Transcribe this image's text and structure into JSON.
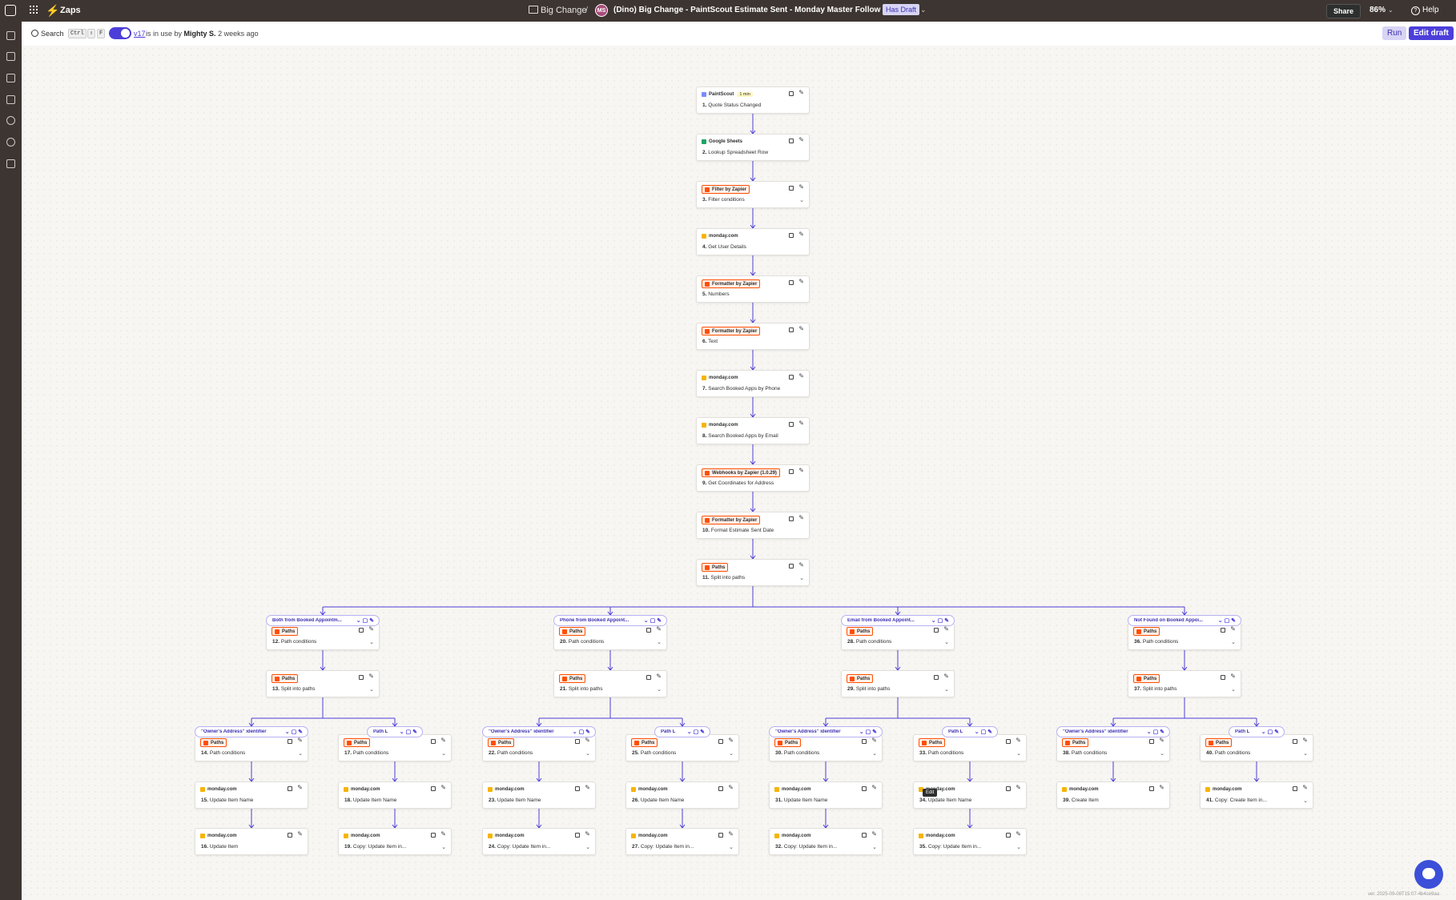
{
  "topbar": {
    "app_name": "Zaps",
    "folder": "Big Change",
    "separator": "/",
    "owner_initials": "MS",
    "zap_title": "(Dino) Big Change - PaintScout Estimate Sent - Monday Master Follow Up Board",
    "draft_badge": "Has Draft",
    "share": "Share",
    "zoom": "86%",
    "help": "Help"
  },
  "subbar": {
    "search": "Search",
    "kbd_ctrl": "Ctrl",
    "kbd_shift": "⇧",
    "kbd_f": "F",
    "version": "v17",
    "in_use_text": "is in use by",
    "user": "Mighty S.",
    "ago": "2 weeks ago",
    "run": "Run",
    "edit_draft": "Edit draft"
  },
  "steps": [
    {
      "app": "PaintScout",
      "num": "1.",
      "title": "Quote Status Changed",
      "time": "1 min",
      "color": "#7a8cff"
    },
    {
      "app": "Google Sheets",
      "num": "2.",
      "title": "Lookup Spreadsheet Row",
      "color": "#1fa463"
    },
    {
      "app": "Filter by Zapier",
      "num": "3.",
      "title": "Filter conditions",
      "color": "#ff4f00"
    },
    {
      "app": "monday.com",
      "num": "4.",
      "title": "Get User Details",
      "color": "#f6b400"
    },
    {
      "app": "Formatter by Zapier",
      "num": "5.",
      "title": "Numbers",
      "color": "#ff4f00"
    },
    {
      "app": "Formatter by Zapier",
      "num": "6.",
      "title": "Text",
      "color": "#ff4f00"
    },
    {
      "app": "monday.com",
      "num": "7.",
      "title": "Search Booked Apps by Phone",
      "color": "#f6b400"
    },
    {
      "app": "monday.com",
      "num": "8.",
      "title": "Search Booked Apps by Email",
      "color": "#f6b400"
    },
    {
      "app": "Webhooks by Zapier (1.0.29)",
      "num": "9.",
      "title": "Get Coordinates for Address",
      "color": "#ff4f00"
    },
    {
      "app": "Formatter by Zapier",
      "num": "10.",
      "title": "Format Estimate Sent Date",
      "color": "#ff4f00"
    },
    {
      "app": "Paths",
      "num": "11.",
      "title": "Split into paths",
      "color": "#ff4f00"
    },
    {
      "app": "Paths",
      "num": "12.",
      "title": "Path conditions",
      "color": "#ff4f00"
    },
    {
      "app": "Paths",
      "num": "13.",
      "title": "Split into paths",
      "color": "#ff4f00"
    },
    {
      "app": "Paths",
      "num": "20.",
      "title": "Path conditions",
      "color": "#ff4f00"
    },
    {
      "app": "Paths",
      "num": "21.",
      "title": "Split into paths",
      "color": "#ff4f00"
    },
    {
      "app": "Paths",
      "num": "28.",
      "title": "Path conditions",
      "color": "#ff4f00"
    },
    {
      "app": "Paths",
      "num": "29.",
      "title": "Split into paths",
      "color": "#ff4f00"
    },
    {
      "app": "Paths",
      "num": "36.",
      "title": "Path conditions",
      "color": "#ff4f00"
    },
    {
      "app": "Paths",
      "num": "37.",
      "title": "Split into paths",
      "color": "#ff4f00"
    },
    {
      "app": "Paths",
      "num": "14.",
      "title": "Path conditions",
      "color": "#ff4f00"
    },
    {
      "app": "monday.com",
      "num": "15.",
      "title": "Update Item Name",
      "color": "#f6b400"
    },
    {
      "app": "monday.com",
      "num": "16.",
      "title": "Update Item",
      "color": "#f6b400"
    },
    {
      "app": "Paths",
      "num": "17.",
      "title": "Path conditions",
      "color": "#ff4f00"
    },
    {
      "app": "monday.com",
      "num": "18.",
      "title": "Update Item Name",
      "color": "#f6b400"
    },
    {
      "app": "monday.com",
      "num": "19.",
      "title": "Copy: Update Item in...",
      "color": "#f6b400"
    },
    {
      "app": "Paths",
      "num": "22.",
      "title": "Path conditions",
      "color": "#ff4f00"
    },
    {
      "app": "monday.com",
      "num": "23.",
      "title": "Update Item Name",
      "color": "#f6b400"
    },
    {
      "app": "monday.com",
      "num": "24.",
      "title": "Copy: Update Item in...",
      "color": "#f6b400"
    },
    {
      "app": "Paths",
      "num": "25.",
      "title": "Path conditions",
      "color": "#ff4f00"
    },
    {
      "app": "monday.com",
      "num": "26.",
      "title": "Update Item Name",
      "color": "#f6b400"
    },
    {
      "app": "monday.com",
      "num": "27.",
      "title": "Copy: Update Item in...",
      "color": "#f6b400"
    },
    {
      "app": "Paths",
      "num": "30.",
      "title": "Path conditions",
      "color": "#ff4f00"
    },
    {
      "app": "monday.com",
      "num": "31.",
      "title": "Update Item Name",
      "color": "#f6b400"
    },
    {
      "app": "monday.com",
      "num": "32.",
      "title": "Copy: Update Item in...",
      "color": "#f6b400"
    },
    {
      "app": "Paths",
      "num": "33.",
      "title": "Path conditions",
      "color": "#ff4f00"
    },
    {
      "app": "monday.com",
      "num": "34.",
      "title": "Update Item Name",
      "color": "#f6b400"
    },
    {
      "app": "monday.com",
      "num": "35.",
      "title": "Copy: Update Item in...",
      "color": "#f6b400"
    },
    {
      "app": "Paths",
      "num": "38.",
      "title": "Path conditions",
      "color": "#ff4f00"
    },
    {
      "app": "monday.com",
      "num": "39.",
      "title": "Create Item",
      "color": "#f6b400"
    },
    {
      "app": "Paths",
      "num": "40.",
      "title": "Path conditions",
      "color": "#ff4f00"
    },
    {
      "app": "monday.com",
      "num": "41.",
      "title": "Copy: Create Item in...",
      "color": "#f6b400"
    }
  ],
  "path_labels": [
    "Both from Booked Appointm...",
    "Phone from Booked Appoint...",
    "Email from Booked Appoint...",
    "Not Found on Booked Appoi...",
    "\"Owner's Address\" identifier",
    "Path L",
    "\"Owner's Address\" identifier",
    "Path L",
    "\"Owner's Address\" identifier",
    "Path L",
    "\"Owner's Address\" identifier",
    "Path L"
  ],
  "tooltip": "Edit",
  "version_footer": "ver. 2025-09-08T15:07-4b4ce9aa",
  "colors": {
    "accent": "#4c3ed9",
    "brand": "#ff4f00",
    "edge": "#4c3ed9"
  }
}
